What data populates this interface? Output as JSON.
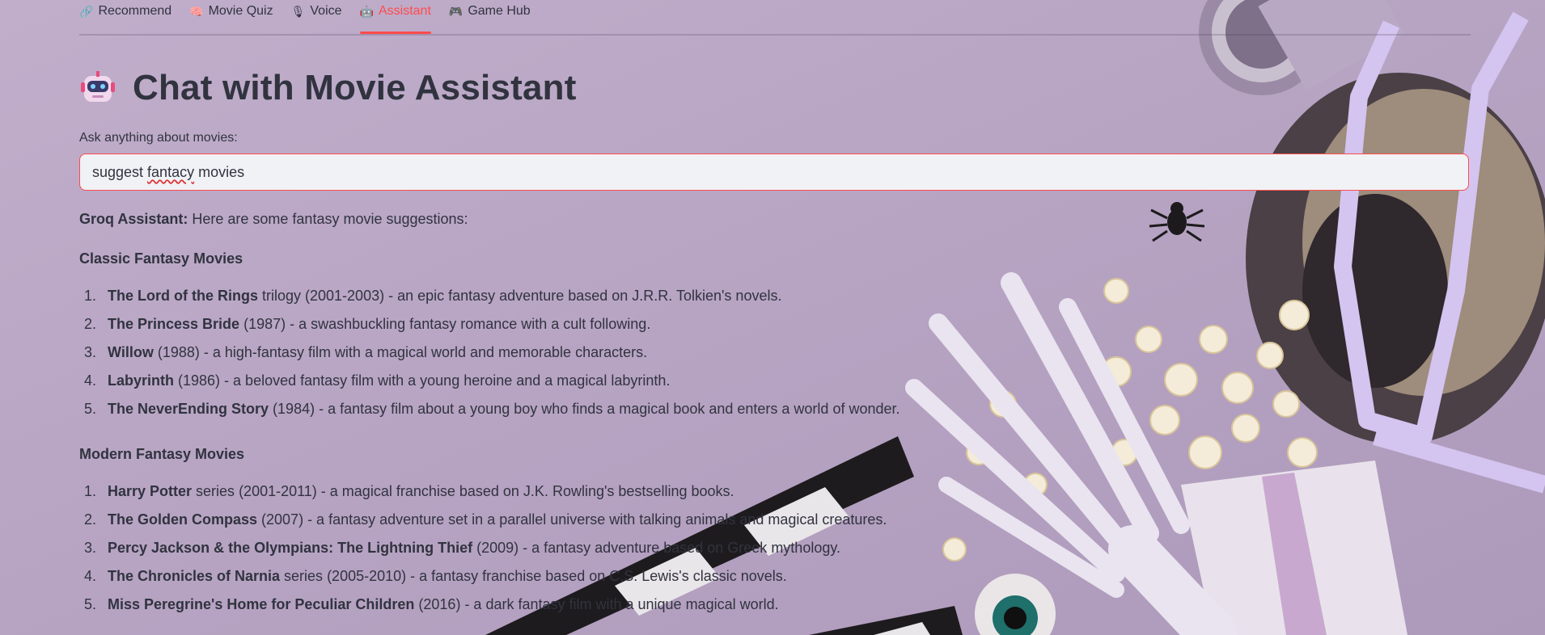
{
  "tabs": [
    {
      "icon": "🔗",
      "icon_name": "link-icon",
      "label": "Recommend",
      "active": false
    },
    {
      "icon": "🧠",
      "icon_name": "brain-icon",
      "label": "Movie Quiz",
      "active": false
    },
    {
      "icon": "🎙",
      "icon_name": "microphone-icon",
      "label": "Voice",
      "active": false
    },
    {
      "icon": "🤖",
      "icon_name": "robot-icon",
      "label": "Assistant",
      "active": true
    },
    {
      "icon": "🎮",
      "icon_name": "gamepad-icon",
      "label": "Game Hub",
      "active": false
    }
  ],
  "page": {
    "title": "Chat with Movie Assistant",
    "input_label": "Ask anything about movies:"
  },
  "query": {
    "before": "suggest ",
    "misspelled": "fantacy",
    "after": " movies"
  },
  "reply": {
    "speaker": "Groq Assistant:",
    "intro": "Here are some fantasy movie suggestions:"
  },
  "sections": [
    {
      "heading": "Classic Fantasy Movies",
      "items": [
        {
          "num": "1.",
          "name": "The Lord of the Rings",
          "rest": "trilogy (2001-2003) - an epic fantasy adventure based on J.R.R. Tolkien's novels."
        },
        {
          "num": "2.",
          "name": "The Princess Bride",
          "rest": "(1987) - a swashbuckling fantasy romance with a cult following."
        },
        {
          "num": "3.",
          "name": "Willow",
          "rest": "(1988) - a high-fantasy film with a magical world and memorable characters."
        },
        {
          "num": "4.",
          "name": "Labyrinth",
          "rest": "(1986) - a beloved fantasy film with a young heroine and a magical labyrinth."
        },
        {
          "num": "5.",
          "name": "The NeverEnding Story",
          "rest": "(1984) - a fantasy film about a young boy who finds a magical book and enters a world of wonder."
        }
      ]
    },
    {
      "heading": "Modern Fantasy Movies",
      "items": [
        {
          "num": "1.",
          "name": "Harry Potter",
          "rest": "series (2001-2011) - a magical franchise based on J.K. Rowling's bestselling books."
        },
        {
          "num": "2.",
          "name": "The Golden Compass",
          "rest": "(2007) - a fantasy adventure set in a parallel universe with talking animals and magical creatures."
        },
        {
          "num": "3.",
          "name": "Percy Jackson & the Olympians: The Lightning Thief",
          "rest": "(2009) - a fantasy adventure based on Greek mythology."
        },
        {
          "num": "4.",
          "name": "The Chronicles of Narnia",
          "rest": "series (2005-2010) - a fantasy franchise based on C.S. Lewis's classic novels."
        },
        {
          "num": "5.",
          "name": "Miss Peregrine's Home for Peculiar Children",
          "rest": "(2016) - a dark fantasy film with a unique magical world."
        }
      ]
    }
  ],
  "colors": {
    "accent": "#ff4b4b",
    "background": "#b9a7c4",
    "text": "#31333f",
    "input_bg": "#f0f2f6"
  }
}
